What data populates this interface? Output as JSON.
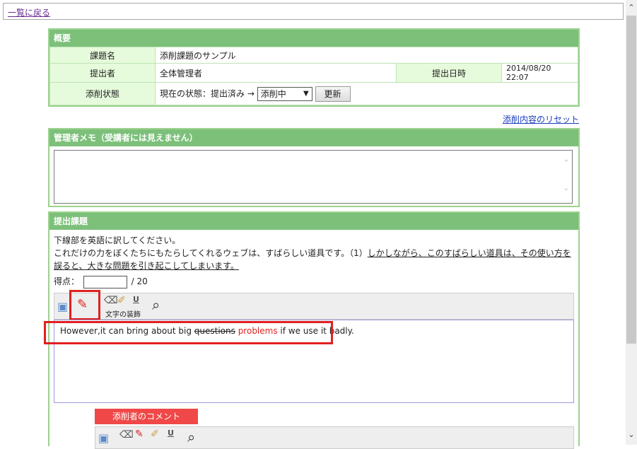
{
  "nav": {
    "back_link": "一覧に戻る"
  },
  "summary": {
    "header": "概要",
    "rows": {
      "title_label": "課題名",
      "title_value": "添削課題のサンプル",
      "submitter_label": "提出者",
      "submitter_value": "全体管理者",
      "date_label": "提出日時",
      "date_value": "2014/08/20 22:07",
      "status_label": "添削状態",
      "status_text": "現在の状態：提出済み →",
      "status_select": "添削中",
      "update_button": "更新"
    }
  },
  "reset_link": "添削内容のリセット",
  "memo": {
    "header": "管理者メモ（受講者には見えません）",
    "value": ""
  },
  "assignment": {
    "header": "提出課題",
    "instruction": "下線部を英語に訳してください。",
    "prompt_plain": "これだけの力をぼくたちにもたらしてくれるウェブは、すばらしい道具です。（1）",
    "prompt_underlined": "しかしながら、このすばらしい道具は、その使い方を誤ると、大きな問題を引き起こしてしまいます。",
    "score_label": "得点：",
    "score_value": "",
    "score_max": "/ 20",
    "toolbar_label": "文字の装飾",
    "answer": {
      "part1": "However,it can bring about big ",
      "struck": "questions",
      "inserted": " problems",
      "part2": " if we use it badly."
    },
    "comment_button": "添削者のコメント"
  },
  "colors": {
    "header_green": "#7cc07a",
    "label_bg": "#e6fbdc",
    "highlight_red": "#e02020",
    "comment_button": "#f04848"
  },
  "icons": [
    "image-icon",
    "pen-icon",
    "eraser-icon",
    "highlighter-icon",
    "underline-icon",
    "preview-icon"
  ]
}
